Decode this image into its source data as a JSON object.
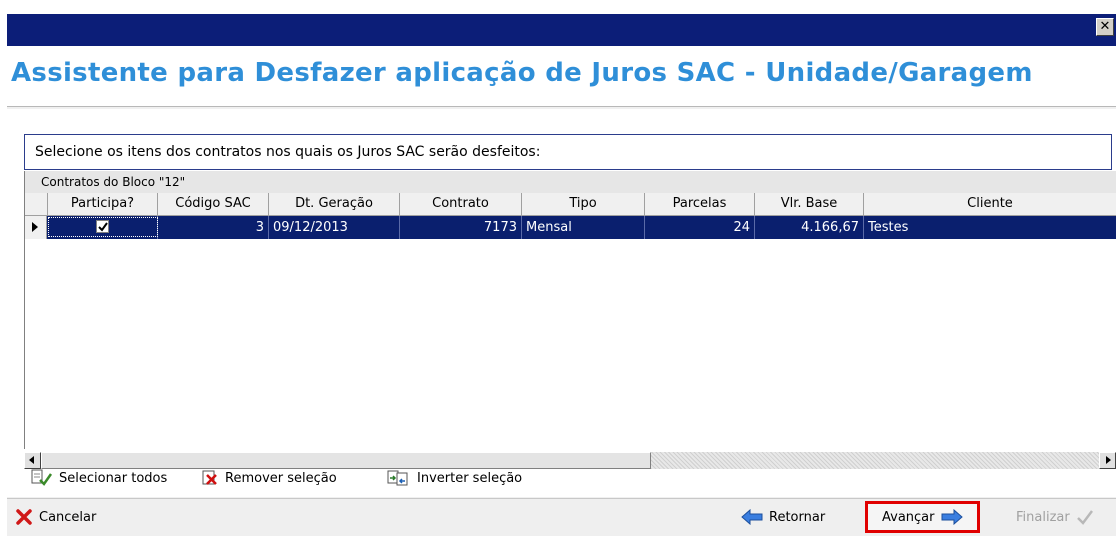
{
  "window": {
    "close_glyph": "✕",
    "title": "Assistente para Desfazer aplicação de Juros SAC - Unidade/Garagem"
  },
  "instruction": "Selecione os itens dos contratos nos quais os Juros SAC serão desfeitos:",
  "grid": {
    "group_title": "Contratos do Bloco \"12\"",
    "columns": [
      "Participa?",
      "Código SAC",
      "Dt. Geração",
      "Contrato",
      "Tipo",
      "Parcelas",
      "Vlr. Base",
      "Cliente"
    ],
    "rows": [
      {
        "participa": true,
        "codigo_sac": "3",
        "dt_geracao": "09/12/2013",
        "contrato": "7173",
        "tipo": "Mensal",
        "parcelas": "24",
        "vlr_base": "4.166,67",
        "cliente": "Testes"
      }
    ]
  },
  "selection_actions": {
    "select_all": "Selecionar todos",
    "remove_selection": "Remover seleção",
    "invert_selection": "Inverter seleção"
  },
  "footer": {
    "cancel": "Cancelar",
    "back": "Retornar",
    "next": "Avançar",
    "finish": "Finalizar"
  },
  "colors": {
    "title_bar": "#0c1e78",
    "heading": "#2f8fd8",
    "selected_row": "#0a1f6e",
    "highlight_border": "#e00000"
  }
}
